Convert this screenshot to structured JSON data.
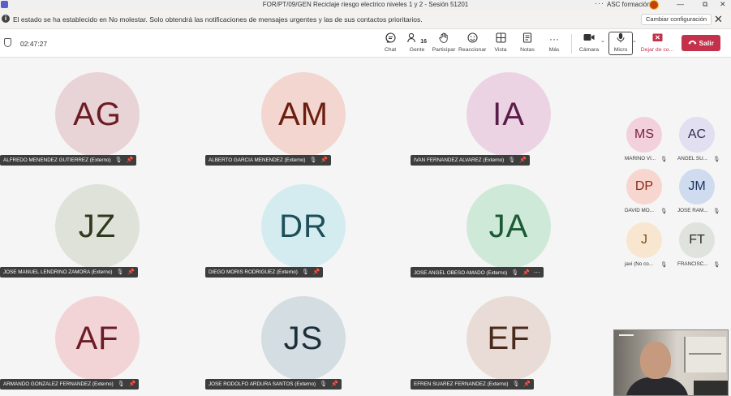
{
  "window": {
    "title": "FOR/PT/09/GEN Reciclaje riesgo electrico niveles 1 y 2 - Sesión 51201",
    "org_name": "ASC formación",
    "more": "···",
    "minimize": "—",
    "restore": "⧉",
    "close": "✕"
  },
  "notification": {
    "message": "El estado se ha establecido en No molestar. Solo obtendrá las notificaciones de mensajes urgentes y las de sus contactos prioritarios.",
    "button_label": "Cambiar configuración",
    "close": "✕"
  },
  "toolbar": {
    "timer": "02:47:27",
    "chat": "Chat",
    "gente": "Gente",
    "gente_count": "16",
    "participar": "Participar",
    "reaccionar": "Reaccionar",
    "vista": "Vista",
    "notas": "Notas",
    "mas": "Más",
    "camara": "Cámara",
    "micro": "Micro",
    "dejar": "Dejar de co...",
    "salir": "Salir"
  },
  "participants": [
    {
      "initials": "AG",
      "name": "ALFREDO MENENDEZ GUTIERREZ (Externo)",
      "bg": "#e8d3d6",
      "fg": "#6b1d23"
    },
    {
      "initials": "AM",
      "name": "ALBERTO GARCIA MENENDEZ (Externo)",
      "bg": "#f3d6cf",
      "fg": "#6b1d10"
    },
    {
      "initials": "IA",
      "name": "IVAN FERNANDEZ ALVAREZ (Externo)",
      "bg": "#ecd3e4",
      "fg": "#5a1d49"
    },
    {
      "initials": "JZ",
      "name": "JOSE MANUEL LENDRINO ZAMORA (Externo)",
      "bg": "#dfe2d9",
      "fg": "#2d3a1d"
    },
    {
      "initials": "DR",
      "name": "DIEGO MORIS RODRIGUEZ (Externo)",
      "bg": "#d4ecf0",
      "fg": "#1c4f5a"
    },
    {
      "initials": "JA",
      "name": "JOSE ANGEL OBESO AMADO (Externo)",
      "bg": "#cfe9d9",
      "fg": "#1b5a34"
    },
    {
      "initials": "AF",
      "name": "ARMANDO GONZALEZ FERNANDEZ (Externo)",
      "bg": "#f3d4d6",
      "fg": "#6b1d27"
    },
    {
      "initials": "JS",
      "name": "JOSE RODOLFO ARDURA SANTOS (Externo)",
      "bg": "#d3dde2",
      "fg": "#1d2f3a"
    },
    {
      "initials": "EF",
      "name": "EFREN SUAREZ FERNANDEZ (Externo)",
      "bg": "#e9dbd5",
      "fg": "#4a2a1a"
    }
  ],
  "side_participants": [
    {
      "initials": "MS",
      "name": "MARINO VI...",
      "bg": "#f2d0dc",
      "fg": "#7a1f40"
    },
    {
      "initials": "AC",
      "name": "ANGEL SU...",
      "bg": "#e1dff0",
      "fg": "#2e2a5a"
    },
    {
      "initials": "DP",
      "name": "DAVID MO...",
      "bg": "#f8d6d0",
      "fg": "#8a2a18"
    },
    {
      "initials": "JM",
      "name": "JOSE RAM...",
      "bg": "#cfdcef",
      "fg": "#1d3560"
    },
    {
      "initials": "J",
      "name": "javi (No co...",
      "bg": "#f8e6d0",
      "fg": "#7a4a12"
    },
    {
      "initials": "FT",
      "name": "FRANCISC...",
      "bg": "#dfe2dd",
      "fg": "#2a2f28"
    }
  ],
  "icons": {
    "mute": "🎙̸",
    "pin": "📌"
  },
  "colors": {
    "salir": "#c4314b",
    "dejar": "#c4314b",
    "namebar": "#3d3d3d",
    "accent": "#5b5fc7"
  }
}
